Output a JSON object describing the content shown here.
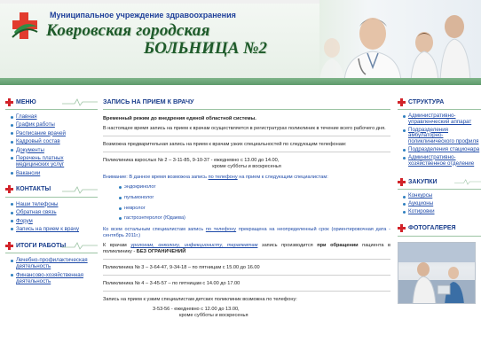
{
  "header": {
    "institution": "Муниципальное учреждение здравоохранения",
    "hospital_line1": "Ковровская городская",
    "hospital_line2": "БОЛЬНИЦА №2"
  },
  "left_sidebar": {
    "menu": {
      "title": "МЕНЮ",
      "items": [
        {
          "label": "Главная"
        },
        {
          "label": "График работы"
        },
        {
          "label": "Расписание врачей"
        },
        {
          "label": "Кадровый состав"
        },
        {
          "label": "Документы"
        },
        {
          "label": "Перечень платных медицинских услуг"
        },
        {
          "label": "Вакансии"
        }
      ]
    },
    "contacts": {
      "title": "КОНТАКТЫ",
      "items": [
        {
          "label": "Наши телефоны"
        },
        {
          "label": "Обратная связь"
        },
        {
          "label": "Форум"
        },
        {
          "label": "Запись на прием к врачу"
        }
      ]
    },
    "results": {
      "title": "ИТОГИ РАБОТЫ",
      "items": [
        {
          "label": "Лечебно-профилактическая деятельность"
        },
        {
          "label": "Финансово-хозяйственная деятельность"
        }
      ]
    }
  },
  "main": {
    "title": "ЗАПИСЬ НА ПРИЕМ К ВРАЧУ",
    "p1": "Временный режим до внедрения единой областной системы.",
    "p2": "В настоящее время запись на прием к врачам осуществляется в регистратурах поликлиник в течение всего рабочего дня.",
    "p3": "Возможна предварительная запись на прием к врачам узких специальностей по следующим телефонам:",
    "clinic2_line": "Поликлиника взрослых № 2 – 3-11-85, 9-10-37 - ежедневно с 13.00 до 14.00,",
    "clinic2_line2": "кроме субботы и воскресенья",
    "attention_prefix": "Внимание: В данное время возможна запись ",
    "attention_link": "по телефону",
    "attention_suffix": " на прием к следующим специалистам:",
    "specialists": [
      {
        "label": "эндокринолог"
      },
      {
        "label": "пульмонолог"
      },
      {
        "label": "невролог"
      },
      {
        "label": "гастроэнтеролог (Юдаева)"
      }
    ],
    "p_other_prefix": "Ко всем остальным специалистам запись ",
    "p_other_link": "по телефону",
    "p_other_suffix": " прекращена на неопределенный срок (ориентировочная дата - сентябрь 2011г.)",
    "p_uro_prefix": "К врачам ",
    "p_uro_links": "урологам, онкологу, инфекционисту, терапевтам",
    "p_uro_mid": " запись производится ",
    "p_uro_bold": "при обращении",
    "p_uro_suffix": " пациента в поликлинику - ",
    "p_uro_end": "БЕЗ ОГРАНИЧЕНИЙ",
    "clinic3": "Поликлиника № 3 – 3-64-47, 9-34-18 – по пятницам с 15.00 до 16.00",
    "clinic4": "Поликлиника № 4 – 3-45-57 – по пятницам с 14.00 до 17.00",
    "kids": "Запись на прием к узким специалистам детских поликлиник возможна по телефону:",
    "kids_phone": "3-53-56 - ежедневно с 12.00 до 13.00,",
    "kids_phone2": "кроме субботы и воскресенья"
  },
  "right_sidebar": {
    "structure": {
      "title": "СТРУКТУРА",
      "items": [
        {
          "label": "Административно-управленческий аппарат"
        },
        {
          "label": "Подразделения амбулаторно-поликлинического профиля"
        },
        {
          "label": "Подразделения стационара"
        },
        {
          "label": "Административно-хозяйственное отделение"
        }
      ]
    },
    "purchases": {
      "title": "ЗАКУПКИ",
      "items": [
        {
          "label": "Конкурсы"
        },
        {
          "label": "Аукционы"
        },
        {
          "label": "Котировки"
        }
      ]
    },
    "gallery": {
      "title": "ФОТОГАЛЕРЕЯ"
    }
  },
  "colors": {
    "accent": "#1a3e8c",
    "cross": "#d2232a",
    "brand_green": "#1e5a2a",
    "link": "#1e4aa8"
  }
}
